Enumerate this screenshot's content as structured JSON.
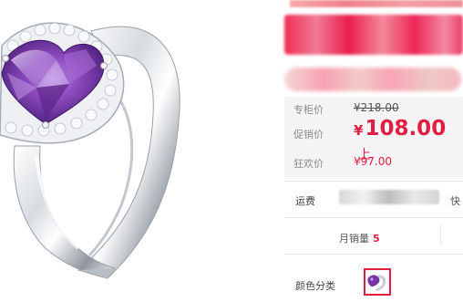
{
  "price_section": {
    "list_price_label": "专柜价",
    "list_price_value": "¥218.00",
    "promo_price_label": "促销价",
    "promo_price_symbol": "¥",
    "promo_price_value": "108.00",
    "promo_price_tail": "上",
    "sale_price_label": "狂欢价",
    "sale_price_value": "¥97.00"
  },
  "shipping": {
    "label": "运费",
    "tail": "快"
  },
  "sales": {
    "label": "月销量",
    "value": "5"
  },
  "color": {
    "label": "颜色分类"
  },
  "colors": {
    "accent": "#e01d43",
    "gem": "#7a35a9"
  }
}
